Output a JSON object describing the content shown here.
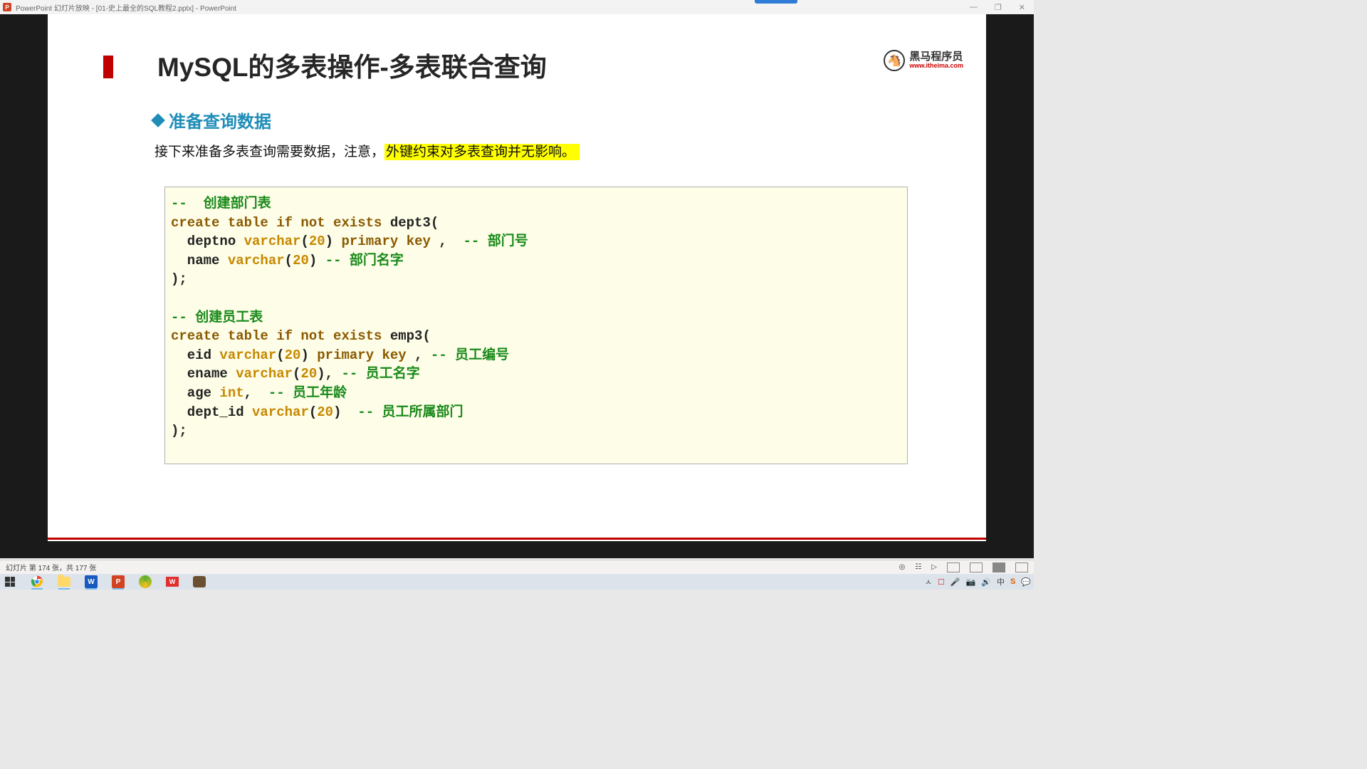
{
  "window": {
    "app_label": "P",
    "title": "PowerPoint 幻灯片放映 - [01-史上最全的SQL教程2.pptx] - PowerPoint",
    "min": "—",
    "max": "❐",
    "close": "✕"
  },
  "slide": {
    "title": "MySQL的多表操作-多表联合查询",
    "logo_cn": "黑马程序员",
    "logo_url": "www.itheima.com",
    "section": "准备查询数据",
    "desc_plain": "接下来准备多表查询需要数据，注意，",
    "desc_hl": "外键约束对多表查询并无影响。",
    "code": {
      "c1": "--  创建部门表",
      "l2_kw": "create table if not exists",
      "l2_rest": " dept3(",
      "l3_a": "  deptno ",
      "l3_ty": "varchar",
      "l3_p1": "(",
      "l3_n": "20",
      "l3_p2": ") ",
      "l3_kw": "primary key ",
      "l3_rest": ",  ",
      "l3_cm": "-- 部门号",
      "l4_a": "  name ",
      "l4_ty": "varchar",
      "l4_p1": "(",
      "l4_n": "20",
      "l4_p2": ") ",
      "l4_cm": "-- 部门名字",
      "l5": ");",
      "blank": "",
      "c2": "-- 创建员工表",
      "l7_kw": "create table if not exists",
      "l7_rest": " emp3(",
      "l8_a": "  eid ",
      "l8_ty": "varchar",
      "l8_p1": "(",
      "l8_n": "20",
      "l8_p2": ") ",
      "l8_kw": "primary key ",
      "l8_rest": ", ",
      "l8_cm": "-- 员工编号",
      "l9_a": "  ename ",
      "l9_ty": "varchar",
      "l9_p1": "(",
      "l9_n": "20",
      "l9_p2": "), ",
      "l9_cm": "-- 员工名字",
      "l10_a": "  age ",
      "l10_ty": "int",
      "l10_rest": ",  ",
      "l10_cm": "-- 员工年龄",
      "l11_a": "  dept_id ",
      "l11_ty": "varchar",
      "l11_p1": "(",
      "l11_n": "20",
      "l11_p2": ")  ",
      "l11_cm": "-- 员工所属部门",
      "l12": ");"
    }
  },
  "status": {
    "slide_counter": "幻灯片 第 174 张，共 177 张"
  },
  "taskbar": {
    "word": "W",
    "pp": "P",
    "wps": "W",
    "tray_up": "ㅅ",
    "tray_items": [
      "☐",
      "🎤",
      "📷",
      "🔊",
      "中",
      "S",
      "💬"
    ]
  }
}
